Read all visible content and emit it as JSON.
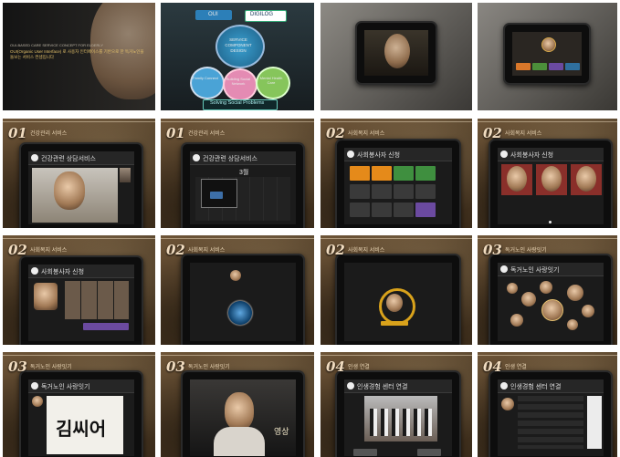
{
  "title_panel": {
    "headline": "OUI(Organic User Interface) 로 사용자 인터페이스를 기반으로 한 독거노인을 돌보는 서비스 컨셉입니다",
    "subline": "OUI-BASED CARE SERVICE CONCEPT FOR ELDERLY"
  },
  "diagram_panel": {
    "top_left_label": "OUI",
    "top_right_label": "DIGILOG",
    "center_label": "SERVICE COMPONENT DESIGN",
    "circle_left": "Family Connect",
    "circle_mid": "Building Social Network",
    "circle_right": "Mental Health Care",
    "footer_label": "Solving Social Problems"
  },
  "panels": [
    {
      "num": "01",
      "section": "건강관리 서비스",
      "screen_title": "건강관련 상담서비스"
    },
    {
      "num": "01",
      "section": "건강관리 서비스",
      "screen_title": "건강관련 상담서비스",
      "calendar_month": "3월"
    },
    {
      "num": "02",
      "section": "사회복지 서비스",
      "screen_title": "사회봉사자 신청"
    },
    {
      "num": "02",
      "section": "사회복지 서비스",
      "screen_title": "사회봉사자 신청"
    },
    {
      "num": "02",
      "section": "사회복지 서비스",
      "screen_title": "사회봉사자 신청"
    },
    {
      "num": "02",
      "section": "사회복지 서비스",
      "screen_title": ""
    },
    {
      "num": "02",
      "section": "사회복지 서비스",
      "screen_title": ""
    },
    {
      "num": "03",
      "section": "독거노인 사랑잇기",
      "screen_title": "독거노인 사랑잇기"
    },
    {
      "num": "03",
      "section": "독거노인 사랑잇기",
      "screen_title": "독거노인 사랑잇기"
    },
    {
      "num": "03",
      "section": "독거노인 사랑잇기",
      "screen_title": "",
      "caption": "영상"
    },
    {
      "num": "04",
      "section": "인생 연결",
      "screen_title": "인생경험 센터 연결"
    },
    {
      "num": "04",
      "section": "인생 연결",
      "screen_title": "인생경험 센터 연결"
    }
  ],
  "cell_a4_ratings": [
    "",
    "",
    ""
  ],
  "calligraphy_text": "김씨어",
  "colors": {
    "paper": "#4d3a24",
    "tablet": "#0d0d0d",
    "accent_orange": "#e58a1a",
    "accent_green": "#3f8f3f",
    "accent_purple": "#6b4aa0",
    "accent_gold": "#d9a21b"
  }
}
